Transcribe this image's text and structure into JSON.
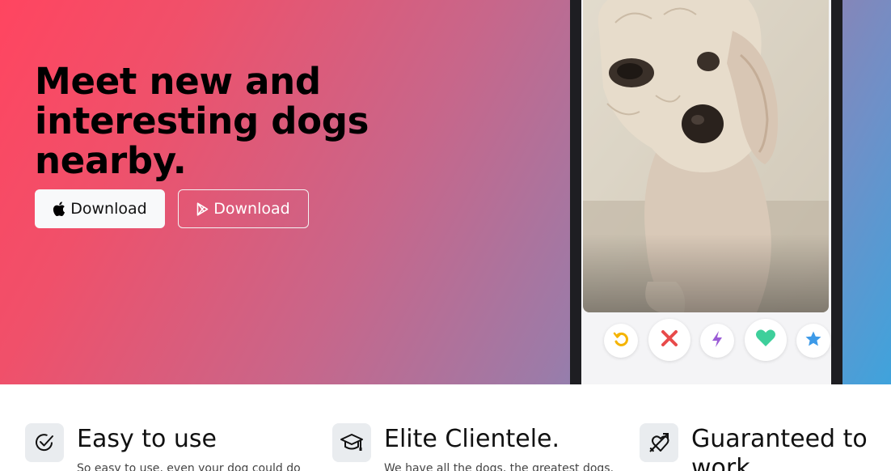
{
  "hero": {
    "title": "Meet new and interesting dogs nearby.",
    "buttons": [
      {
        "label": "Download",
        "icon": "apple-icon"
      },
      {
        "label": "Download",
        "icon": "google-play-icon"
      }
    ],
    "gradient": [
      "#ff4560",
      "#c8668a",
      "#9c7ba8",
      "#3fa3dc"
    ]
  },
  "phone": {
    "photo": "dog-photo",
    "actions": [
      {
        "icon": "rewind-icon",
        "color": "#f5b400"
      },
      {
        "icon": "close-icon",
        "color": "#e84a4a"
      },
      {
        "icon": "lightning-icon",
        "color": "#9b5cd6"
      },
      {
        "icon": "heart-icon",
        "color": "#3ecf9b"
      },
      {
        "icon": "star-icon",
        "color": "#3d9ae8"
      }
    ]
  },
  "features": [
    {
      "icon": "check-circle-icon",
      "title": "Easy to use",
      "text": "So easy to use, even your dog could do"
    },
    {
      "icon": "mortarboard-icon",
      "title": "Elite Clientele.",
      "text": "We have all the dogs, the greatest dogs."
    },
    {
      "icon": "arrow-through-heart-icon",
      "title": "Guaranteed to work",
      "text": ""
    }
  ]
}
